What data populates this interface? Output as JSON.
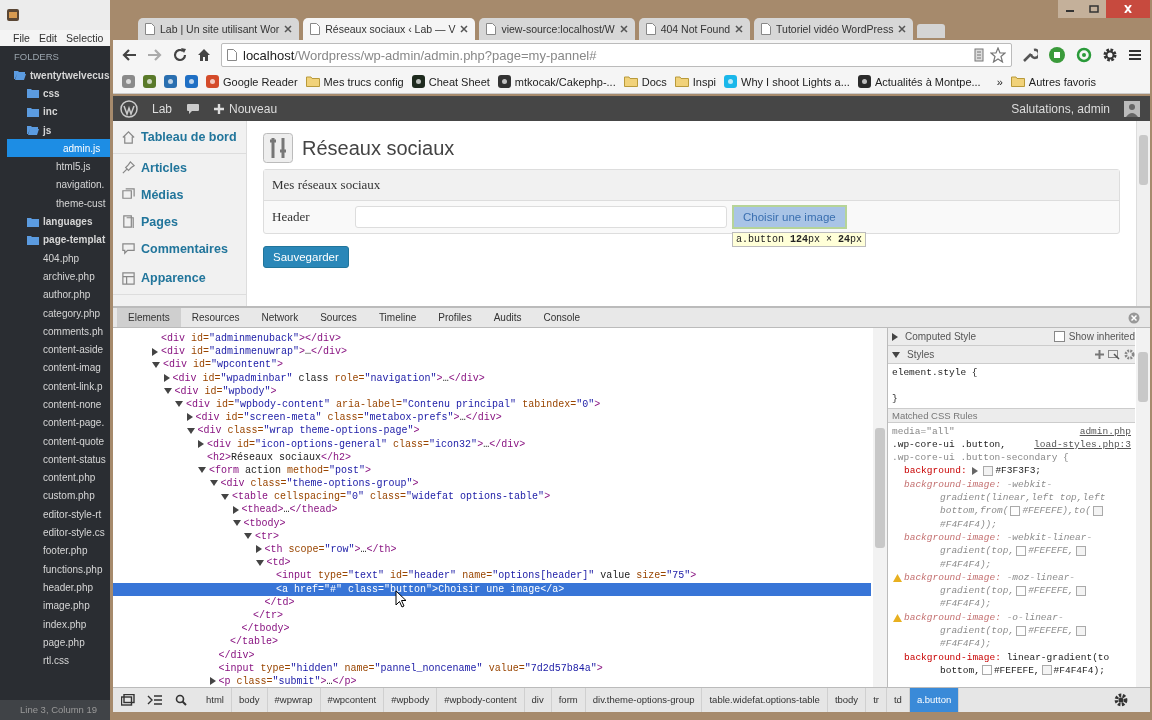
{
  "editor": {
    "menu": [
      "File",
      "Edit",
      "Selectio"
    ],
    "sidebar_title": "FOLDERS",
    "tree": [
      {
        "kind": "folder",
        "name": "twentytwelvecus",
        "expanded": true,
        "selected": false,
        "children": [
          {
            "kind": "folder",
            "name": "css",
            "expanded": false,
            "selected": false
          },
          {
            "kind": "folder",
            "name": "inc",
            "expanded": false,
            "selected": false
          },
          {
            "kind": "folder",
            "name": "js",
            "expanded": true,
            "selected": false,
            "children": [
              {
                "kind": "file",
                "name": "admin.js",
                "selected": true
              },
              {
                "kind": "file",
                "name": "html5.js",
                "selected": false
              },
              {
                "kind": "file",
                "name": "navigation.",
                "selected": false
              },
              {
                "kind": "file",
                "name": "theme-cust",
                "selected": false
              }
            ]
          },
          {
            "kind": "folder",
            "name": "languages",
            "expanded": false,
            "selected": false
          },
          {
            "kind": "folder",
            "name": "page-templat",
            "expanded": false,
            "selected": false
          },
          {
            "kind": "file",
            "name": "404.php",
            "selected": false
          },
          {
            "kind": "file",
            "name": "archive.php",
            "selected": false
          },
          {
            "kind": "file",
            "name": "author.php",
            "selected": false
          },
          {
            "kind": "file",
            "name": "category.php",
            "selected": false
          },
          {
            "kind": "file",
            "name": "comments.ph",
            "selected": false
          },
          {
            "kind": "file",
            "name": "content-aside",
            "selected": false
          },
          {
            "kind": "file",
            "name": "content-imag",
            "selected": false
          },
          {
            "kind": "file",
            "name": "content-link.p",
            "selected": false
          },
          {
            "kind": "file",
            "name": "content-none",
            "selected": false
          },
          {
            "kind": "file",
            "name": "content-page.",
            "selected": false
          },
          {
            "kind": "file",
            "name": "content-quote",
            "selected": false
          },
          {
            "kind": "file",
            "name": "content-status",
            "selected": false
          },
          {
            "kind": "file",
            "name": "content.php",
            "selected": false
          },
          {
            "kind": "file",
            "name": "custom.php",
            "selected": false
          },
          {
            "kind": "file",
            "name": "editor-style-rt",
            "selected": false
          },
          {
            "kind": "file",
            "name": "editor-style.cs",
            "selected": false
          },
          {
            "kind": "file",
            "name": "footer.php",
            "selected": false
          },
          {
            "kind": "file",
            "name": "functions.php",
            "selected": false
          },
          {
            "kind": "file",
            "name": "header.php",
            "selected": false
          },
          {
            "kind": "file",
            "name": "image.php",
            "selected": false
          },
          {
            "kind": "file",
            "name": "index.php",
            "selected": false
          },
          {
            "kind": "file",
            "name": "page.php",
            "selected": false
          },
          {
            "kind": "file",
            "name": "rtl.css",
            "selected": false
          }
        ]
      }
    ],
    "status": "Line 3, Column 19"
  },
  "browser": {
    "tabs": [
      {
        "title": "Lab | Un site utilisant Wor",
        "selected": false
      },
      {
        "title": "Réseaux sociaux ‹ Lab — V",
        "selected": true
      },
      {
        "title": "view-source:localhost/W",
        "selected": false
      },
      {
        "title": "404 Not Found",
        "selected": false
      },
      {
        "title": "Tutoriel vidéo WordPress",
        "selected": false
      }
    ],
    "address": {
      "host": "localhost",
      "path": "/Wordpress/wp-admin/admin.php?page=my-pannel#"
    },
    "bookmarks": [
      {
        "kind": "site",
        "color": "#8a8a8a"
      },
      {
        "kind": "site",
        "color": "#5a7a2a"
      },
      {
        "kind": "site",
        "color": "#2a6fb0"
      },
      {
        "kind": "site",
        "color": "#1f6fc4"
      },
      {
        "kind": "site",
        "label": "Google Reader",
        "color": "#d44b2a"
      },
      {
        "kind": "folder",
        "label": "Mes trucs config"
      },
      {
        "kind": "site",
        "label": "Cheat Sheet",
        "color": "#1e2a1e"
      },
      {
        "kind": "site",
        "label": "mtkocak/Cakephp-...",
        "color": "#333333"
      },
      {
        "kind": "folder",
        "label": "Docs"
      },
      {
        "kind": "folder",
        "label": "Inspi"
      },
      {
        "kind": "site",
        "label": "Why I shoot Lights a...",
        "color": "#1ab7ea"
      },
      {
        "kind": "site",
        "label": "Actualités à Montpe...",
        "color": "#2b2b2b"
      }
    ],
    "more": "»",
    "other": "Autres favoris"
  },
  "wp": {
    "adminbar": {
      "site": "Lab",
      "new": "Nouveau",
      "greeting": "Salutations, admin"
    },
    "menu": [
      {
        "label": "Tableau de bord",
        "kind": "home"
      },
      {
        "label": "Articles",
        "kind": "pin"
      },
      {
        "label": "Médias",
        "kind": "media"
      },
      {
        "label": "Pages",
        "kind": "pages"
      },
      {
        "label": "Commentaires",
        "kind": "comments"
      },
      {
        "label": "Apparence",
        "kind": "appearance"
      }
    ],
    "title": "Réseaux sociaux",
    "section": "Mes réseaux sociaux",
    "field_label": "Header",
    "choose_button": "Choisir une image",
    "inspected": true,
    "inspect_tooltip": "a.button **124**px × **24**px",
    "save_button": "Sauvegarder"
  },
  "devtools": {
    "tabs": [
      {
        "label": "Elements",
        "selected": true
      },
      {
        "label": "Resources",
        "selected": false
      },
      {
        "label": "Network",
        "selected": false
      },
      {
        "label": "Sources",
        "selected": false
      },
      {
        "label": "Timeline",
        "selected": false
      },
      {
        "label": "Profiles",
        "selected": false
      },
      {
        "label": "Audits",
        "selected": false
      },
      {
        "label": "Console",
        "selected": false
      }
    ],
    "dom": [
      {
        "text": "<div id=\"adminmenuback\"></div>",
        "selected": false
      },
      {
        "text": "<div id=\"adminmenuwrap\">…</div>",
        "expanded": false,
        "selected": false
      },
      {
        "text": "<div id=\"wpcontent\">",
        "expanded": true,
        "selected": false,
        "children": [
          {
            "text": "<div id=\"wpadminbar\" class role=\"navigation\">…</div>",
            "expanded": false,
            "selected": false
          },
          {
            "text": "<div id=\"wpbody\">",
            "expanded": true,
            "selected": false,
            "children": [
              {
                "text": "<div id=\"wpbody-content\" aria-label=\"Contenu principal\" tabindex=\"0\">",
                "expanded": true,
                "selected": false,
                "children": [
                  {
                    "text": "<div id=\"screen-meta\" class=\"metabox-prefs\">…</div>",
                    "expanded": false,
                    "selected": false
                  },
                  {
                    "text": "<div class=\"wrap theme-options-page\">",
                    "expanded": true,
                    "selected": false,
                    "children": [
                      {
                        "text": "<div id=\"icon-options-general\" class=\"icon32\">…</div>",
                        "expanded": false,
                        "selected": false
                      },
                      {
                        "text": "<h2>Réseaux sociaux</h2>",
                        "selected": false
                      },
                      {
                        "text": "<form action method=\"post\">",
                        "expanded": true,
                        "selected": false,
                        "children": [
                          {
                            "text": "<div class=\"theme-options-group\">",
                            "expanded": true,
                            "selected": false,
                            "close": "</div>",
                            "children": [
                              {
                                "text": "<table cellspacing=\"0\" class=\"widefat options-table\">",
                                "expanded": true,
                                "selected": false,
                                "close": "</table>",
                                "children": [
                                  {
                                    "text": "<thead>…</thead>",
                                    "expanded": false,
                                    "selected": false
                                  },
                                  {
                                    "text": "<tbody>",
                                    "expanded": true,
                                    "selected": false,
                                    "close": "</tbody>",
                                    "children": [
                                      {
                                        "text": "<tr>",
                                        "expanded": true,
                                        "selected": false,
                                        "close": "</tr>",
                                        "children": [
                                          {
                                            "text": "<th scope=\"row\">…</th>",
                                            "expanded": false,
                                            "selected": false
                                          },
                                          {
                                            "text": "<td>",
                                            "expanded": true,
                                            "selected": false,
                                            "close": "</td>",
                                            "children": [
                                              {
                                                "text": "<input type=\"text\" id=\"header\" name=\"options[header]\" value size=\"75\">",
                                                "selected": false
                                              },
                                              {
                                                "text": "<a href=\"#\" class=\"button\">Choisir une image</a>",
                                                "selected": true
                                              }
                                            ]
                                          }
                                        ]
                                      }
                                    ]
                                  }
                                ]
                              }
                            ]
                          },
                          {
                            "text": "<input type=\"hidden\" name=\"pannel_noncename\" value=\"7d2d57b84a\">",
                            "selected": false
                          },
                          {
                            "text": "<p class=\"submit\">…</p>",
                            "expanded": false,
                            "selected": false
                          }
                        ]
                      }
                    ]
                  }
                ]
              }
            ]
          }
        ]
      }
    ],
    "styles": {
      "computed_label": "Computed Style",
      "computed_expanded": false,
      "show_inherited": "Show inherited",
      "show_inherited_checked": false,
      "styles_label": "Styles",
      "styles_expanded": true,
      "element_open": "element.style {",
      "element_close": "}",
      "matched_label": "Matched CSS Rules",
      "media": "media=\"all\"",
      "source": "admin.php",
      "selectors": [
        ".wp-core-ui .button,",
        ".wp-core-ui .button-secondary {"
      ],
      "source2": "load-styles.php:3",
      "properties": [
        {
          "name": "background:",
          "overridden": false,
          "warning": false,
          "expander": true,
          "parts": [
            {
              "kind": "color",
              "text": "#F3F3F3"
            },
            {
              "kind": "text",
              "text": ";"
            }
          ]
        },
        {
          "name": "background-image:",
          "overridden": true,
          "warning": false,
          "expander": false,
          "parts": [
            {
              "kind": "text",
              "text": "-webkit-gradient(linear,left top,left bottom,from("
            },
            {
              "kind": "color",
              "text": "#FEFEFE"
            },
            {
              "kind": "text",
              "text": "),to("
            },
            {
              "kind": "color",
              "text": "#F4F4F4"
            },
            {
              "kind": "text",
              "text": "));"
            }
          ]
        },
        {
          "name": "background-image:",
          "overridden": true,
          "warning": false,
          "expander": false,
          "parts": [
            {
              "kind": "text",
              "text": "-webkit-linear-gradient(top,"
            },
            {
              "kind": "color",
              "text": "#FEFEFE"
            },
            {
              "kind": "text",
              "text": ","
            },
            {
              "kind": "color",
              "text": "#F4F4F4"
            },
            {
              "kind": "text",
              "text": ");"
            }
          ]
        },
        {
          "name": "background-image:",
          "overridden": true,
          "warning": true,
          "expander": false,
          "parts": [
            {
              "kind": "text",
              "text": "-moz-linear-gradient(top,"
            },
            {
              "kind": "color",
              "text": "#FEFEFE"
            },
            {
              "kind": "text",
              "text": ","
            },
            {
              "kind": "color",
              "text": "#F4F4F4"
            },
            {
              "kind": "text",
              "text": ");"
            }
          ]
        },
        {
          "name": "background-image:",
          "overridden": true,
          "warning": true,
          "expander": false,
          "parts": [
            {
              "kind": "text",
              "text": "-o-linear-gradient(top,"
            },
            {
              "kind": "color",
              "text": "#FEFEFE"
            },
            {
              "kind": "text",
              "text": ","
            },
            {
              "kind": "color",
              "text": "#F4F4F4"
            },
            {
              "kind": "text",
              "text": ");"
            }
          ]
        },
        {
          "name": "background-image:",
          "overridden": false,
          "warning": false,
          "expander": false,
          "parts": [
            {
              "kind": "text",
              "text": "linear-gradient(to bottom,"
            },
            {
              "kind": "color",
              "text": "#FEFEFE"
            },
            {
              "kind": "text",
              "text": ","
            },
            {
              "kind": "color",
              "text": "#F4F4F4"
            },
            {
              "kind": "text",
              "text": ");"
            }
          ]
        }
      ]
    },
    "crumbs": [
      {
        "label": "html",
        "selected": false
      },
      {
        "label": "body",
        "selected": false
      },
      {
        "label": "#wpwrap",
        "selected": false
      },
      {
        "label": "#wpcontent",
        "selected": false
      },
      {
        "label": "#wpbody",
        "selected": false
      },
      {
        "label": "#wpbody-content",
        "selected": false
      },
      {
        "label": "div",
        "selected": false
      },
      {
        "label": "form",
        "selected": false
      },
      {
        "label": "div.theme-options-group",
        "selected": false
      },
      {
        "label": "table.widefat.options-table",
        "selected": false
      },
      {
        "label": "tbody",
        "selected": false
      },
      {
        "label": "tr",
        "selected": false
      },
      {
        "label": "td",
        "selected": false
      },
      {
        "label": "a.button",
        "selected": true
      }
    ]
  }
}
